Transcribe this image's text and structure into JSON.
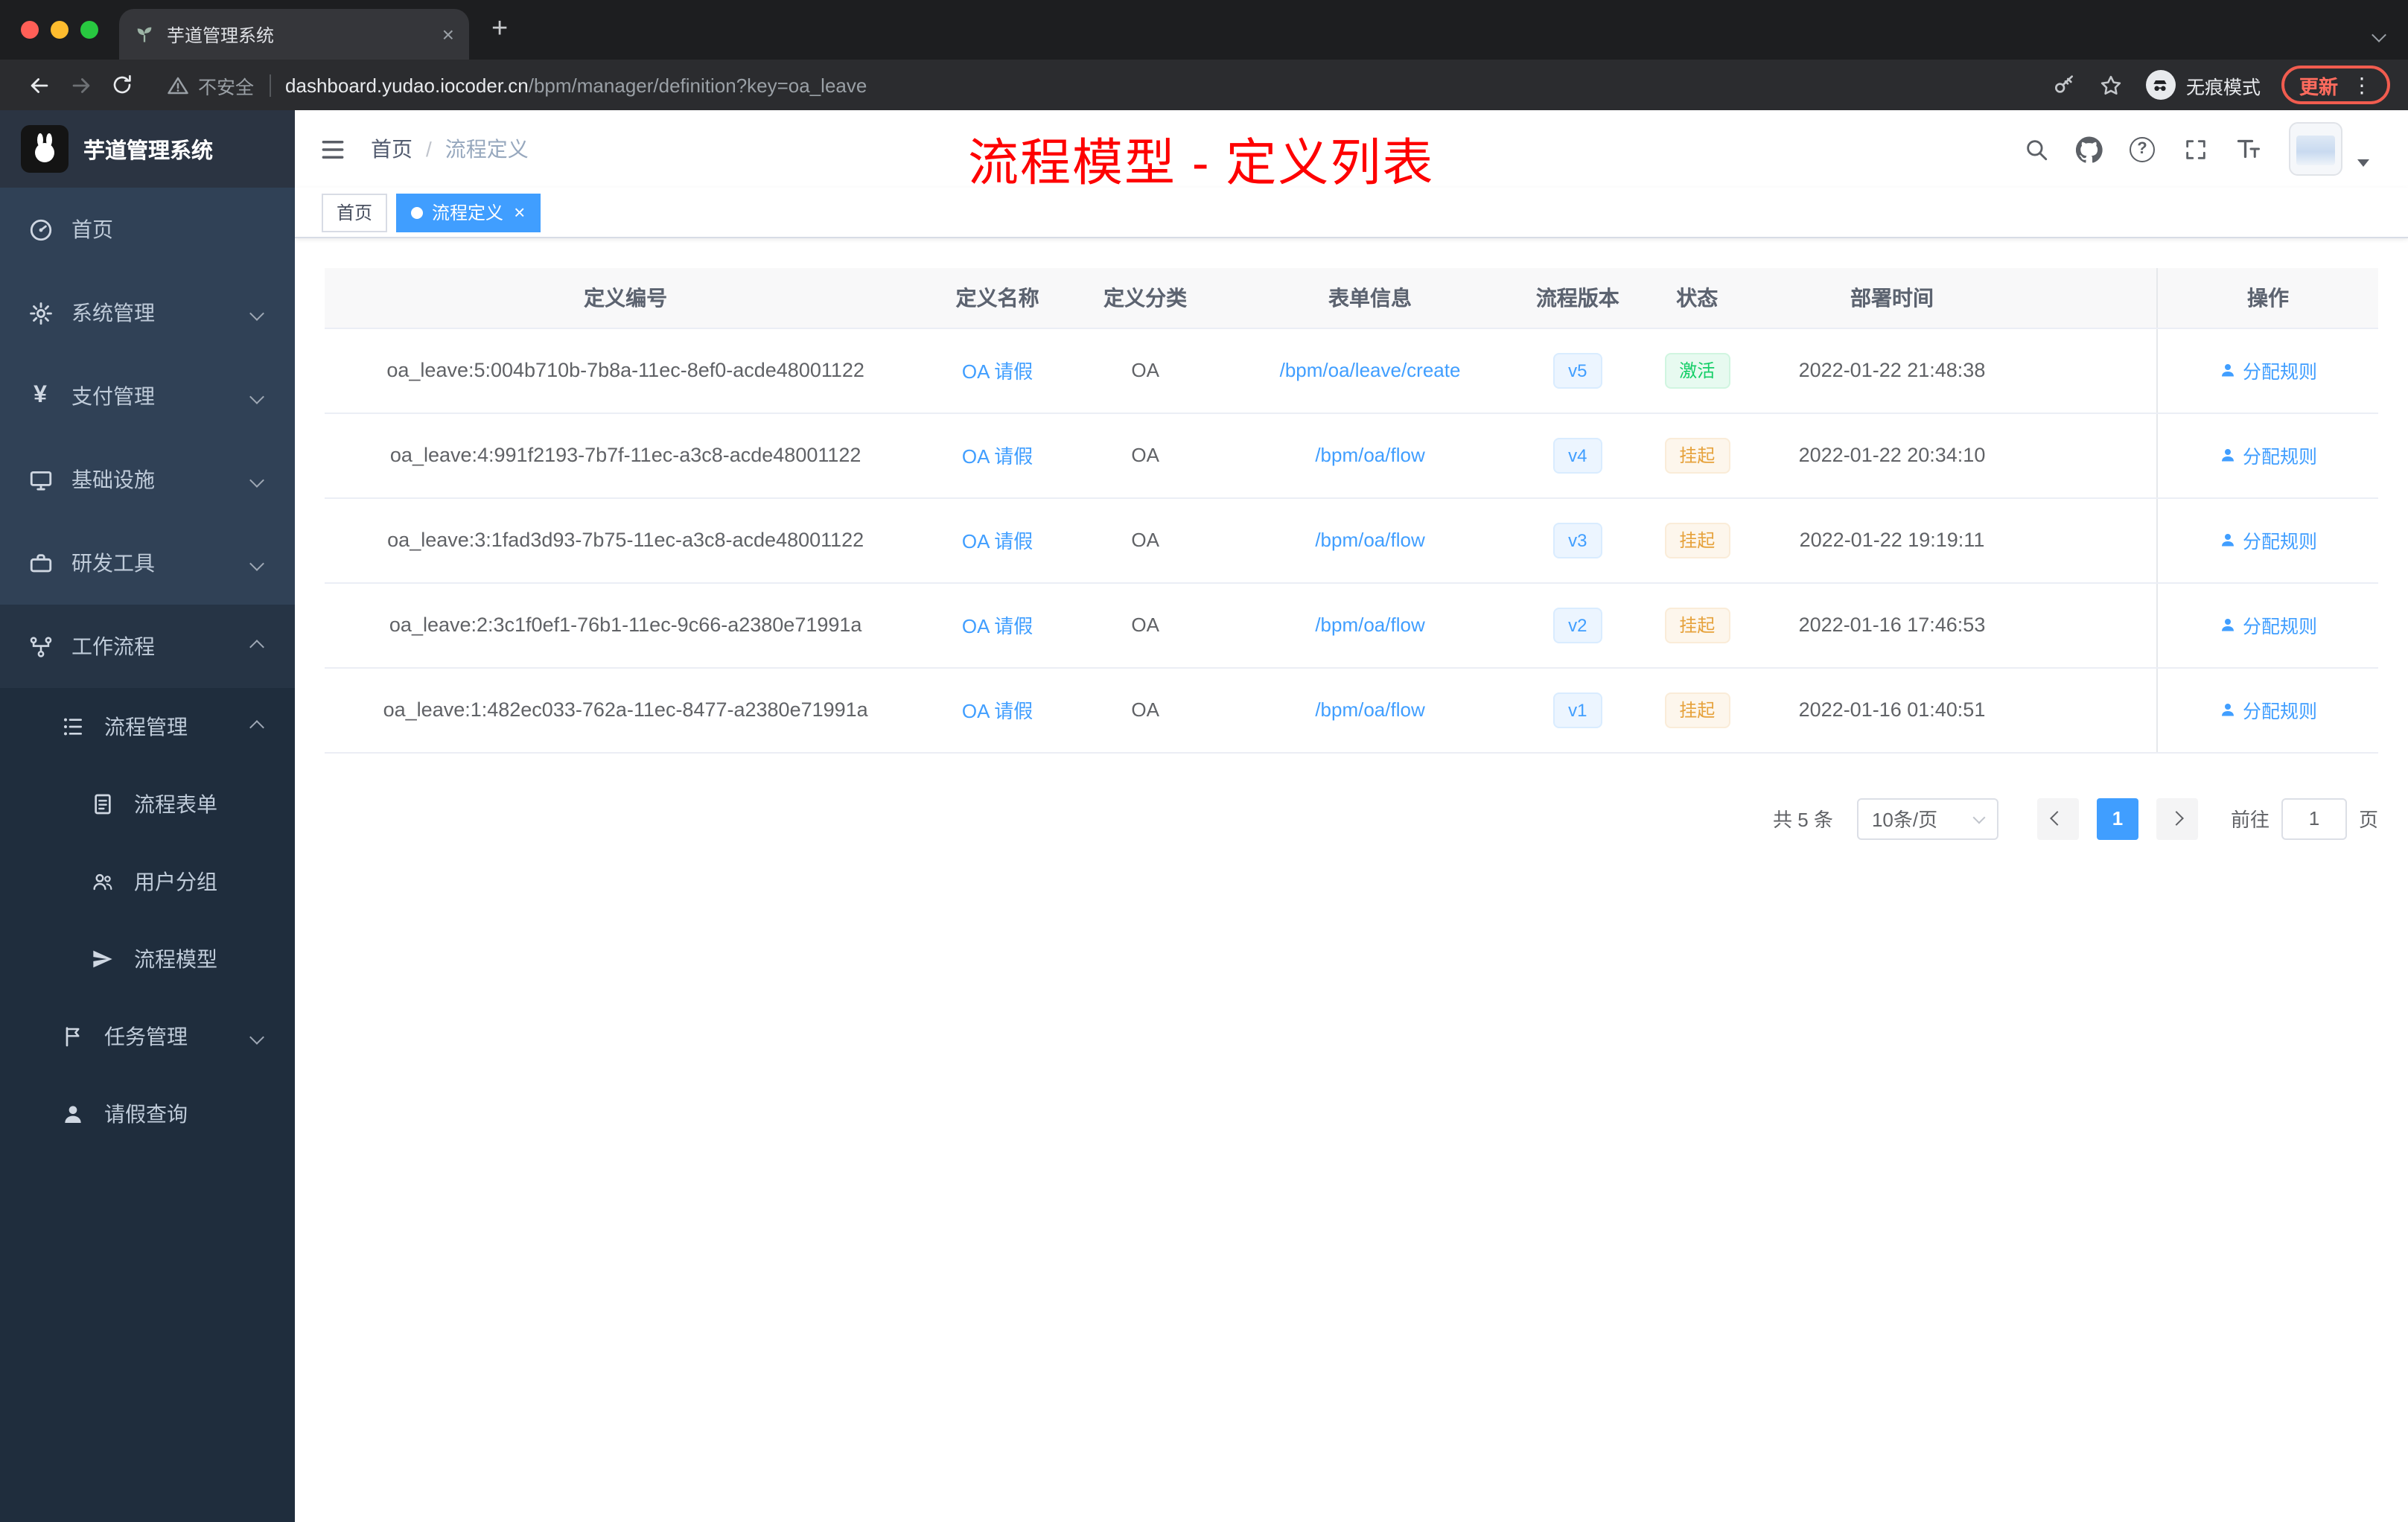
{
  "glyphs": {
    "close": "×",
    "new_tab": "+",
    "kebab": "⋮",
    "question": "?"
  },
  "browser": {
    "tab_title": "芋道管理系统",
    "security_label": "不安全",
    "url_domain": "dashboard.yudao.iocoder.cn",
    "url_path": "/bpm/manager/definition?key=oa_leave",
    "incognito_label": "无痕模式",
    "update_label": "更新"
  },
  "sidebar": {
    "logo_title": "芋道管理系统",
    "items": [
      {
        "label": "首页"
      },
      {
        "label": "系统管理"
      },
      {
        "label": "支付管理"
      },
      {
        "label": "基础设施"
      },
      {
        "label": "研发工具"
      },
      {
        "label": "工作流程"
      },
      {
        "label": "流程管理"
      },
      {
        "label": "流程表单"
      },
      {
        "label": "用户分组"
      },
      {
        "label": "流程模型"
      },
      {
        "label": "任务管理"
      },
      {
        "label": "请假查询"
      }
    ]
  },
  "navbar": {
    "breadcrumb_home": "首页",
    "breadcrumb_sep": "/",
    "breadcrumb_current": "流程定义",
    "annotation": "流程模型 - 定义列表"
  },
  "tags": {
    "home": "首页",
    "active": "流程定义"
  },
  "table": {
    "headers": [
      "定义编号",
      "定义名称",
      "定义分类",
      "表单信息",
      "流程版本",
      "状态",
      "部署时间",
      "操作"
    ],
    "rows": [
      {
        "id": "oa_leave:5:004b710b-7b8a-11ec-8ef0-acde48001122",
        "name": "OA 请假",
        "category": "OA",
        "form": "/bpm/oa/leave/create",
        "version": "v5",
        "status": "激活",
        "time": "2022-01-22 21:48:38",
        "action": "分配规则"
      },
      {
        "id": "oa_leave:4:991f2193-7b7f-11ec-a3c8-acde48001122",
        "name": "OA 请假",
        "category": "OA",
        "form": "/bpm/oa/flow",
        "version": "v4",
        "status": "挂起",
        "time": "2022-01-22 20:34:10",
        "action": "分配规则"
      },
      {
        "id": "oa_leave:3:1fad3d93-7b75-11ec-a3c8-acde48001122",
        "name": "OA 请假",
        "category": "OA",
        "form": "/bpm/oa/flow",
        "version": "v3",
        "status": "挂起",
        "time": "2022-01-22 19:19:11",
        "action": "分配规则"
      },
      {
        "id": "oa_leave:2:3c1f0ef1-76b1-11ec-9c66-a2380e71991a",
        "name": "OA 请假",
        "category": "OA",
        "form": "/bpm/oa/flow",
        "version": "v2",
        "status": "挂起",
        "time": "2022-01-16 17:46:53",
        "action": "分配规则"
      },
      {
        "id": "oa_leave:1:482ec033-762a-11ec-8477-a2380e71991a",
        "name": "OA 请假",
        "category": "OA",
        "form": "/bpm/oa/flow",
        "version": "v1",
        "status": "挂起",
        "time": "2022-01-16 01:40:51",
        "action": "分配规则"
      }
    ]
  },
  "pagination": {
    "total": "共 5 条",
    "page_size": "10条/页",
    "current_page": "1",
    "goto_label": "前往",
    "goto_value": "1",
    "page_unit": "页"
  },
  "colors": {
    "accent": "#409EFF",
    "success": "#13ce66",
    "warning": "#e6a23c",
    "annotation_red": "#fe0000",
    "sidebar_bg": "#304156",
    "sidebar_sub_bg": "#1f2d3d"
  }
}
